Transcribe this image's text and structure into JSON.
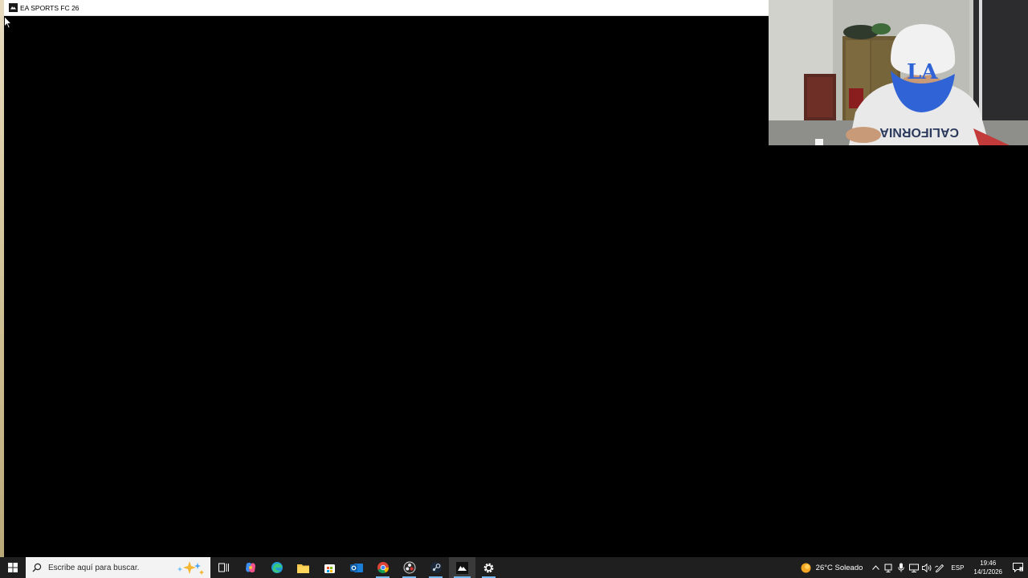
{
  "window": {
    "title": "EA SPORTS FC 26"
  },
  "taskbar": {
    "search_placeholder": "Escribe aquí para buscar.",
    "apps": [
      {
        "name": "task-view-icon"
      },
      {
        "name": "copilot-icon"
      },
      {
        "name": "edge-icon"
      },
      {
        "name": "file-explorer-icon"
      },
      {
        "name": "microsoft-store-icon"
      },
      {
        "name": "outlook-icon"
      },
      {
        "name": "chrome-icon"
      },
      {
        "name": "obs-icon"
      },
      {
        "name": "steam-icon"
      },
      {
        "name": "ea-app-icon"
      },
      {
        "name": "settings-icon"
      }
    ],
    "weather": "26°C  Soleado",
    "language": "ESP",
    "time": "19:46",
    "date": "14/1/2026"
  },
  "colors": {
    "taskbar_bg": "#1f1f1f",
    "accent_indicator": "#76b9ed",
    "titlebar_bg": "#ffffff",
    "game_bg": "#000000"
  }
}
